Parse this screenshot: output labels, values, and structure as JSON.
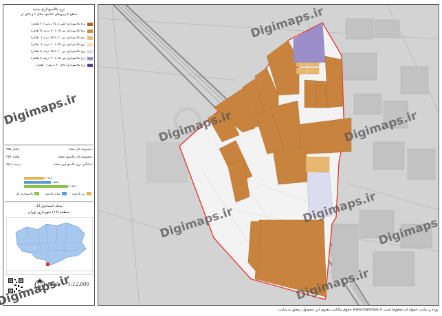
{
  "legend": {
    "title_line1": "نرخ بالاسوداری جدید",
    "title_line2": "سطح کاربری‌های بالاسود ملاک ۱ و بالای آن",
    "items": [
      {
        "label": "نرخ بالاسوداری کمتر از ۱۵ درصد (۲۰ هکتار)",
        "color": "#b5651d"
      },
      {
        "label": "نرخ بالاسوداری بین ۱۵ تا ۳۰ درصد (۲ هکتار)",
        "color": "#d08a3c"
      },
      {
        "label": "نرخ بالاسوداری بین ۳۰ تا ۴۵ درصد (۰ هکتار)",
        "color": "#e8b873"
      },
      {
        "label": "نرخ بالاسوداری بین ۴۵ تا ۶۰ درصد (۰ هکتار)",
        "color": "#f5e0b8"
      },
      {
        "label": "نرخ بالاسوداری بین ۶۰ تا ۷۵ درصد (۱ هکتار)",
        "color": "#dcdcf0"
      },
      {
        "label": "نرخ بالاسوداری بین ۷۵ تا ۹۰ درصد (۱ هکتار)",
        "color": "#9a8fc8"
      },
      {
        "label": "نرخ بالاسوداری بالای ۹۰ درصد (۰ هکتار)",
        "color": "#5b3f8f"
      }
    ]
  },
  "stats": {
    "row1_label": "مجموعه کل محله:",
    "row1_value": "۳۵۵ هکتار",
    "row2_label": "مجموعه کل بالاسود محله:",
    "row2_value": "۲۷۷ هکتار",
    "row3_label": "میانگین نرخ بالاسوداری محله:",
    "row3_value": "۷۵٫۱ درصد"
  },
  "bars": [
    {
      "value_label": "۲٫۱۸۴",
      "color": "#e8b448",
      "fraction": 0.42
    },
    {
      "value_label": "۱٫۵۸۸",
      "color": "#5a9bd5",
      "fraction": 0.55
    },
    {
      "value_label": "۲٫۷۷۲",
      "color": "#8bc34a",
      "fraction": 0.92
    }
  ],
  "bar_keys": [
    {
      "label": "بالاسوداری کل",
      "color": "#8bc34a"
    },
    {
      "label": "میانه بالاسود",
      "color": "#5a9bd5"
    },
    {
      "label": "زیر بالاسود",
      "color": "#e8b448"
    }
  ],
  "inset": {
    "title_line1": "محله اسماعیل آباد",
    "title_line2": "منطقه (۱۹) شهرداری تهران",
    "city_color": "#a9c8f0",
    "marker_color": "#e53935"
  },
  "scale_text": "Scale = 1:12,000",
  "map": {
    "watermark": "Digimaps.ir",
    "boundary_color": "#e53935",
    "block_color": "#c8843f"
  },
  "footer": "حقوق مالکیت معنوی این محصول متعلق به سایت www.digimaps.ir بوده و تمامی حقوق آن محفوظ است."
}
